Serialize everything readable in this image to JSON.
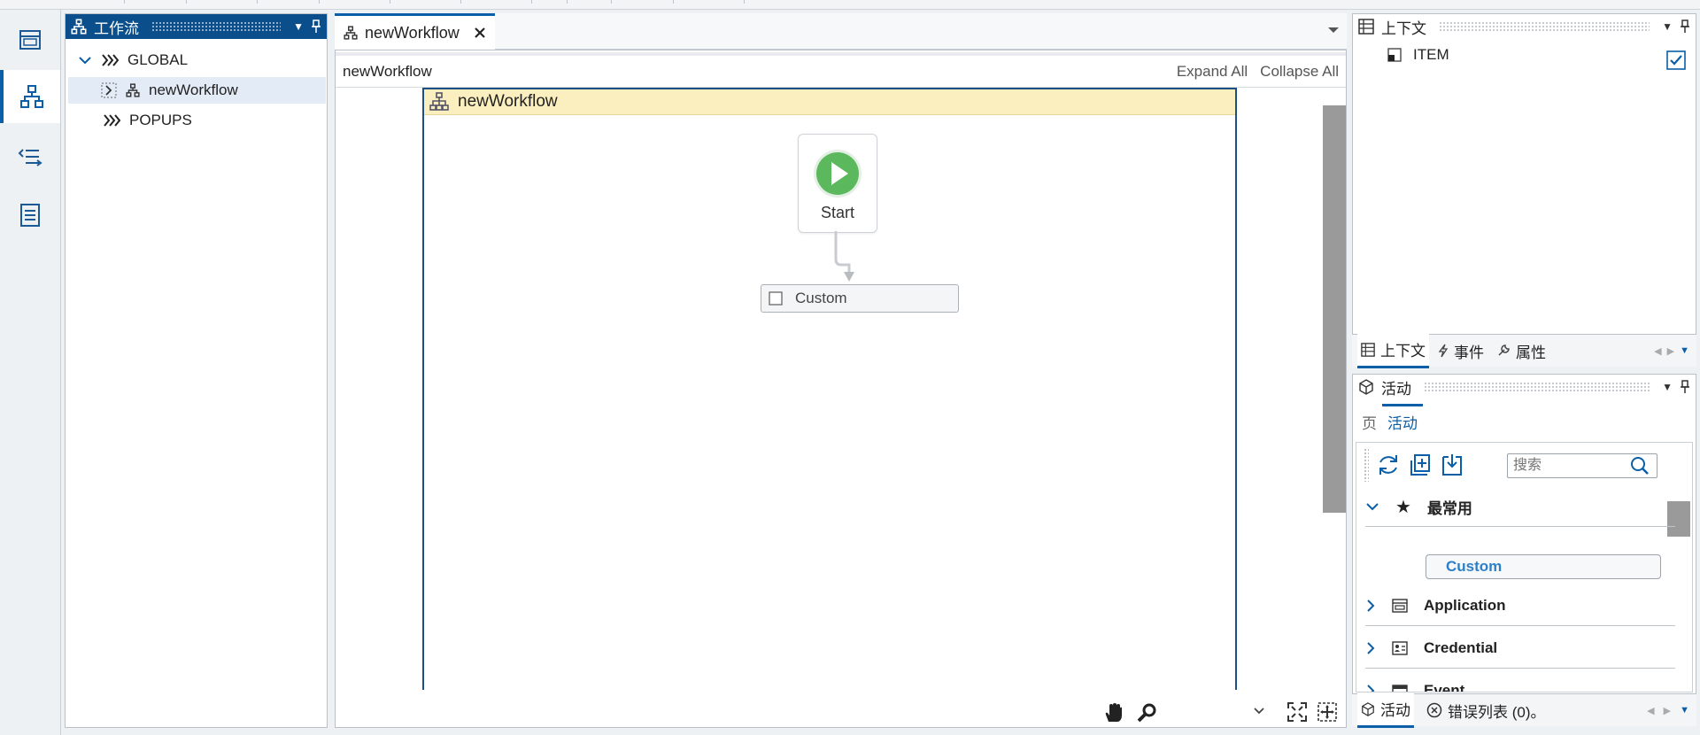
{
  "colors": {
    "accent": "#0a5fa8",
    "title_bar": "#0a4f8c",
    "workflow_header": "#fcefbf",
    "start_green": "#5cb85c",
    "custom_link": "#2d7fc8"
  },
  "left_panel": {
    "title": "工作流",
    "tree": [
      {
        "label": "GLOBAL",
        "icon": "chevron-down-icon",
        "expanded": true
      },
      {
        "label": "newWorkflow",
        "icon": "workflow-icon",
        "selected": true
      },
      {
        "label": "POPUPS",
        "icon": "chevron-right-icon",
        "expanded": false
      }
    ]
  },
  "editor": {
    "tab_label": "newWorkflow",
    "header_title": "newWorkflow",
    "expand_all": "Expand All",
    "collapse_all": "Collapse All",
    "workflow_title": "newWorkflow",
    "start_label": "Start",
    "custom_label": "Custom"
  },
  "context_panel": {
    "title": "上下文",
    "items": [
      {
        "label": "ITEM",
        "checked": true
      }
    ]
  },
  "middle_tabs": [
    {
      "label": "上下文",
      "icon": "context-icon",
      "active": true
    },
    {
      "label": "事件",
      "icon": "lightning-icon",
      "active": false
    },
    {
      "label": "属性",
      "icon": "wrench-icon",
      "active": false
    }
  ],
  "activity_panel": {
    "title": "活动",
    "subtabs": [
      {
        "label": "页",
        "active": false
      },
      {
        "label": "活动",
        "active": true
      }
    ],
    "search_placeholder": "搜索",
    "categories": [
      {
        "label": "最常用",
        "icon": "star-icon",
        "expanded": true,
        "children": [
          "Custom"
        ]
      },
      {
        "label": "Application",
        "icon": "application-icon",
        "expanded": false
      },
      {
        "label": "Credential",
        "icon": "credential-icon",
        "expanded": false
      },
      {
        "label": "Event",
        "icon": "calendar-icon",
        "expanded": false
      }
    ]
  },
  "bottom_tabs": [
    {
      "label": "活动",
      "icon": "cube-icon",
      "active": true
    },
    {
      "label": "错误列表 (0)。",
      "icon": "error-circle-icon",
      "active": false
    }
  ]
}
